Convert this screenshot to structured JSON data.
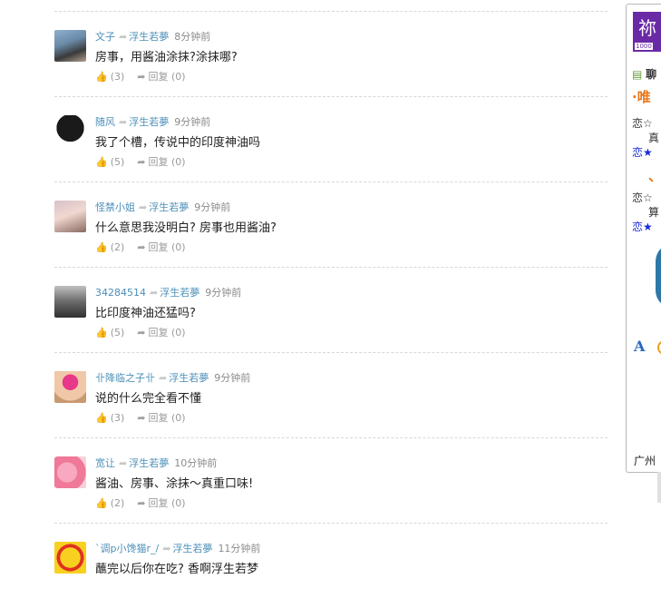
{
  "comments": [
    {
      "user": "文子",
      "target": "浮生若夢",
      "time": "8分钟前",
      "text": "房事，用酱油涂抹?涂抹哪?",
      "likes": "(3)",
      "reply": "回复 (0)",
      "avatar": "photo-dark"
    },
    {
      "user": "随风",
      "target": "浮生若夢",
      "time": "9分钟前",
      "text": "我了个槽，传说中的印度神油吗",
      "likes": "(5)",
      "reply": "回复 (0)",
      "avatar": "qq-penguin"
    },
    {
      "user": "怪禁小姐",
      "target": "浮生若夢",
      "time": "9分钟前",
      "text": "什么意思我没明白? 房事也用酱油?",
      "likes": "(2)",
      "reply": "回复 (0)",
      "avatar": "girl-photo"
    },
    {
      "user": "34284514",
      "target": "浮生若夢",
      "time": "9分钟前",
      "text": "比印度神油还猛吗?",
      "likes": "(5)",
      "reply": "回复 (0)",
      "avatar": "photo-gray"
    },
    {
      "user": "卝降临之子卝",
      "target": "浮生若夢",
      "time": "9分钟前",
      "text": "说的什么完全看不懂",
      "likes": "(3)",
      "reply": "回复 (0)",
      "avatar": "baby-photo"
    },
    {
      "user": "宽让",
      "target": "浮生若夢",
      "time": "10分钟前",
      "text": "酱油、房事、涂抹～真重口味!",
      "likes": "(2)",
      "reply": "回复 (0)",
      "avatar": "pink-flower"
    },
    {
      "user": "`调p小馋猫r_/",
      "target": "浮生若夢",
      "time": "11分钟前",
      "text": "蘸完以后你在吃? 香啊浮生若梦",
      "likes": "",
      "reply": "",
      "avatar": "cartoon-bee"
    }
  ],
  "sidebar": {
    "logo_text": "祢",
    "logo_badge": "1000",
    "row1": "聊",
    "row2": "·唯",
    "row3": "恋☆",
    "row4": "真",
    "row5": "恋★",
    "row6": "、",
    "row7": "恋☆",
    "row8": "算",
    "row9": "恋★",
    "letter_a": "A",
    "footer": "广州"
  },
  "colors": {
    "link": "#4c8fb8",
    "accent_orange": "#e8761a",
    "star_blue": "#1a2ad8"
  }
}
